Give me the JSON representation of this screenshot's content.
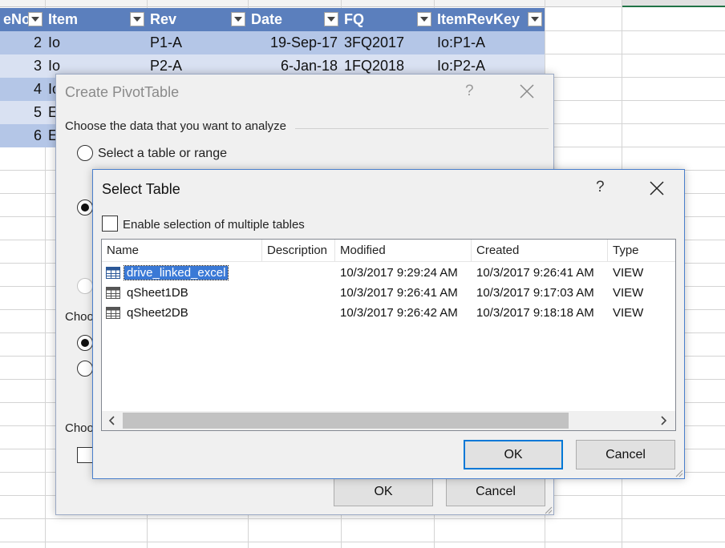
{
  "sheet": {
    "headers": [
      "eNo",
      "Item",
      "Rev",
      "Date",
      "FQ",
      "ItemRevKey"
    ],
    "rows": [
      [
        "2",
        "Io",
        "P1-A",
        "19-Sep-17",
        "3FQ2017",
        "Io:P1-A"
      ],
      [
        "3",
        "Io",
        "P2-A",
        "6-Jan-18",
        "1FQ2018",
        "Io:P2-A"
      ],
      [
        "4",
        "Io"
      ],
      [
        "5",
        "E"
      ],
      [
        "6",
        "E"
      ]
    ]
  },
  "pivot_dialog": {
    "title": "Create PivotTable",
    "help": "?",
    "section1": "Choose the data that you want to analyze",
    "radio_select_table": "Select a table or range",
    "section2_fragment": "Choo",
    "section3_fragment": "Choo",
    "ok": "OK",
    "cancel": "Cancel"
  },
  "select_table_dialog": {
    "title": "Select Table",
    "help": "?",
    "enable_multiple": "Enable selection of multiple tables",
    "columns": [
      "Name",
      "Description",
      "Modified",
      "Created",
      "Type"
    ],
    "rows": [
      {
        "name": "drive_linked_excel",
        "description": "",
        "modified": "10/3/2017 9:29:24 AM",
        "created": "10/3/2017 9:26:41 AM",
        "type": "VIEW",
        "icon": "table-icon"
      },
      {
        "name": "qSheet1DB",
        "description": "",
        "modified": "10/3/2017 9:26:41 AM",
        "created": "10/3/2017 9:17:03 AM",
        "type": "VIEW",
        "icon": "table-icon"
      },
      {
        "name": "qSheet2DB",
        "description": "",
        "modified": "10/3/2017 9:26:42 AM",
        "created": "10/3/2017 9:18:18 AM",
        "type": "VIEW",
        "icon": "table-icon"
      }
    ],
    "selected_row": 0,
    "ok": "OK",
    "cancel": "Cancel"
  },
  "colors": {
    "table_header": "#5b7fbd",
    "band_dark": "#b4c6e7",
    "band_light": "#d9e1f2",
    "selection": "#3a79d6",
    "default_button_border": "#0078d7"
  }
}
